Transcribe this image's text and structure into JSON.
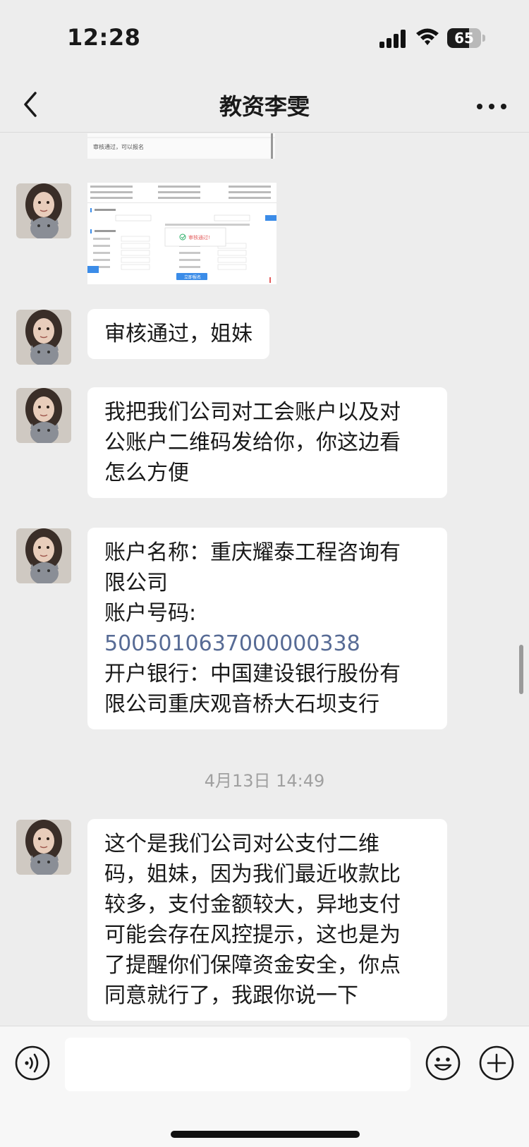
{
  "status_bar": {
    "time": "12:28",
    "battery": "65",
    "battery_level": 0.65
  },
  "header": {
    "title": "教资李雯"
  },
  "chat": {
    "top_image_caption": "审核通过，可以报名",
    "success_toast": "审核通过!",
    "submit_label": "立即报名",
    "messages": [
      {
        "type": "text",
        "lines": [
          "审核通过，姐妹"
        ]
      },
      {
        "type": "text",
        "lines": [
          "我把我们公司对工会账户以及对",
          "公账户二维码发给你，你这边看",
          "怎么方便"
        ]
      },
      {
        "type": "account",
        "name_lines": [
          "账户名称：重庆耀泰工程咨询有",
          "限公司"
        ],
        "number_label": "账户号码:",
        "number": "5005010637000000338",
        "bank_lines": [
          "开户银行：中国建设银行股份有",
          "限公司重庆观音桥大石坝支行"
        ]
      },
      {
        "type": "text",
        "lines": [
          "这个是我们公司对公支付二维",
          "码，姐妹，因为我们最近收款比",
          "较多，支付金额较大，异地支付",
          "可能会存在风控提示，这也是为",
          "了提醒你们保障资金安全，你点",
          "同意就行了，我跟你说一下"
        ]
      }
    ],
    "timestamp": "4月13日 14:49"
  },
  "input": {
    "placeholder": ""
  },
  "colors": {
    "background": "#ededed",
    "bubble": "#ffffff",
    "link": "#576b95",
    "accent_blue": "#3b8ce8"
  }
}
